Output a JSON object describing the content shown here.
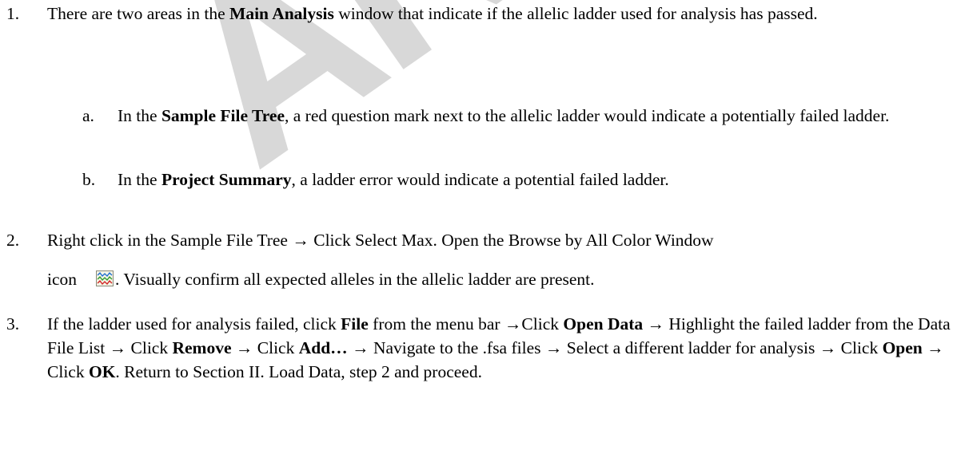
{
  "watermark": "ARCHIVED",
  "steps": [
    {
      "number": "1.",
      "segments": [
        {
          "t": "There are two areas in the ",
          "b": false
        },
        {
          "t": "Main Analysis",
          "b": true
        },
        {
          "t": " window that indicate if the allelic ladder used for analysis has passed.",
          "b": false
        }
      ],
      "substeps": [
        {
          "letter": "a.",
          "segments": [
            {
              "t": "In the ",
              "b": false
            },
            {
              "t": "Sample File Tree",
              "b": true
            },
            {
              "t": ", a red question mark next to the allelic ladder would indicate a potentially failed ladder.",
              "b": false
            }
          ]
        },
        {
          "letter": "b.",
          "segments": [
            {
              "t": "In the ",
              "b": false
            },
            {
              "t": "Project Summary",
              "b": true
            },
            {
              "t": ", a ladder error would indicate a potential failed ladder.",
              "b": false
            }
          ]
        }
      ]
    },
    {
      "number": "2.",
      "line1": "Right click in the Sample File Tree → Click Select Max. Open the Browse by All Color Window",
      "line2_prefix": "icon",
      "icon_name": "browse-all-color-window-icon",
      "line2_suffix": ". Visually confirm all expected alleles in the allelic ladder are present."
    },
    {
      "number": "3.",
      "segments": [
        {
          "t": "If the ladder used for analysis failed, click ",
          "b": false
        },
        {
          "t": "File",
          "b": true
        },
        {
          "t": " from the menu bar →Click ",
          "b": false
        },
        {
          "t": "Open Data",
          "b": true
        },
        {
          "t": " → Highlight the failed ladder from the Data File List → Click ",
          "b": false
        },
        {
          "t": "Remove",
          "b": true
        },
        {
          "t": " → Click ",
          "b": false
        },
        {
          "t": "Add…",
          "b": true
        },
        {
          "t": " → Navigate to the .fsa files → Select a different ladder for analysis → Click ",
          "b": false
        },
        {
          "t": "Open",
          "b": true
        },
        {
          "t": "  → Click ",
          "b": false
        },
        {
          "t": "OK",
          "b": true
        },
        {
          "t": ". Return to Section II. Load Data, step 2 and proceed.",
          "b": false
        }
      ]
    }
  ]
}
